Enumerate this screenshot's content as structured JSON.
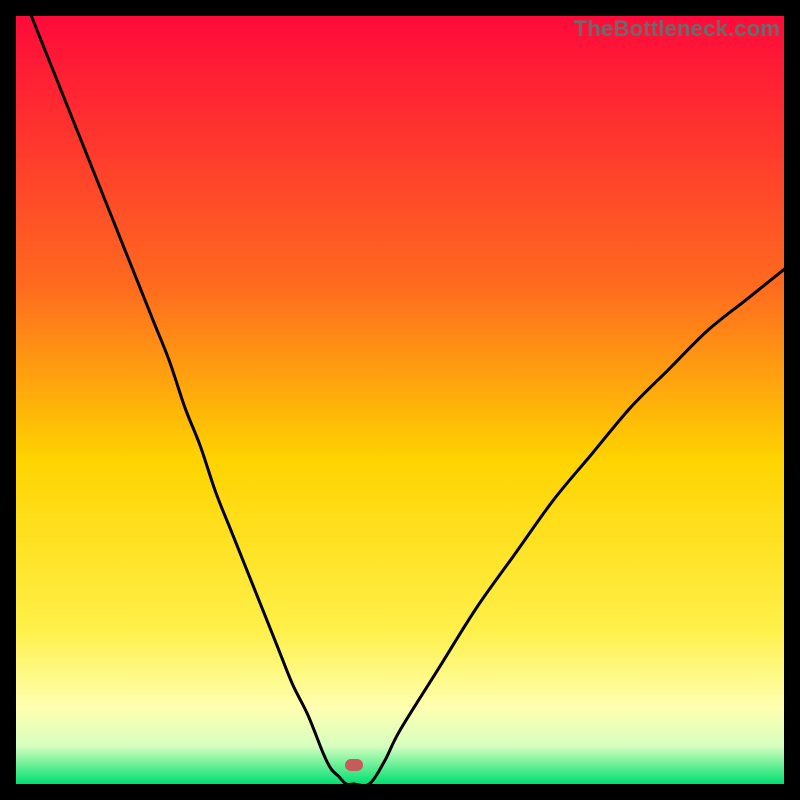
{
  "watermark": "TheBottleneck.com",
  "colors": {
    "background": "#000000",
    "gradient_top": "#ff0a3a",
    "gradient_mid_upper": "#ff6a1f",
    "gradient_mid": "#ffd400",
    "gradient_low": "#ffffb0",
    "gradient_bottom": "#00e070",
    "curve": "#000000",
    "marker": "#c85a5a"
  },
  "marker": {
    "x_frac": 0.44,
    "y_frac": 0.975
  },
  "chart_data": {
    "type": "line",
    "title": "",
    "xlabel": "",
    "ylabel": "",
    "xlim": [
      0,
      1
    ],
    "ylim": [
      0,
      100
    ],
    "series": [
      {
        "name": "bottleneck-curve",
        "x": [
          0.02,
          0.04,
          0.06,
          0.08,
          0.1,
          0.12,
          0.14,
          0.16,
          0.18,
          0.2,
          0.22,
          0.24,
          0.26,
          0.28,
          0.3,
          0.32,
          0.34,
          0.36,
          0.38,
          0.4,
          0.41,
          0.42,
          0.43,
          0.44,
          0.46,
          0.48,
          0.5,
          0.55,
          0.6,
          0.65,
          0.7,
          0.75,
          0.8,
          0.85,
          0.9,
          0.95,
          1.0
        ],
        "y": [
          100,
          95,
          90,
          85,
          80,
          75,
          70,
          65,
          60,
          55,
          49,
          44,
          38,
          33,
          28,
          23,
          18,
          13,
          9,
          4,
          2,
          1,
          0,
          0,
          0,
          3,
          7,
          15,
          23,
          30,
          37,
          43,
          49,
          54,
          59,
          63,
          67
        ]
      }
    ],
    "annotations": [
      {
        "name": "optimal-marker",
        "x": 0.44,
        "y": 0
      }
    ],
    "background_gradient": {
      "stops": [
        {
          "offset": 0.0,
          "color": "#ff0a3a"
        },
        {
          "offset": 0.35,
          "color": "#ff6a1f"
        },
        {
          "offset": 0.58,
          "color": "#ffd400"
        },
        {
          "offset": 0.8,
          "color": "#fff04a"
        },
        {
          "offset": 0.9,
          "color": "#ffffb0"
        },
        {
          "offset": 0.95,
          "color": "#d8ffc0"
        },
        {
          "offset": 1.0,
          "color": "#00e070"
        }
      ]
    }
  }
}
